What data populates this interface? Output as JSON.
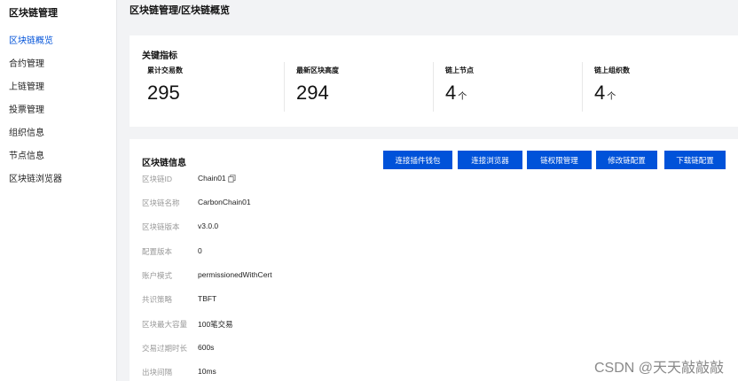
{
  "sidebar": {
    "title": "区块链管理",
    "items": [
      {
        "label": "区块链概览",
        "active": true
      },
      {
        "label": "合约管理",
        "active": false
      },
      {
        "label": "上链管理",
        "active": false
      },
      {
        "label": "投票管理",
        "active": false
      },
      {
        "label": "组织信息",
        "active": false
      },
      {
        "label": "节点信息",
        "active": false
      },
      {
        "label": "区块链浏览器",
        "active": false
      }
    ]
  },
  "header": {
    "breadcrumb": "区块链管理/区块链概览"
  },
  "kpi": {
    "title": "关键指标",
    "metrics": [
      {
        "label": "累计交易数",
        "value": "295",
        "unit": ""
      },
      {
        "label": "最新区块高度",
        "value": "294",
        "unit": ""
      },
      {
        "label": "链上节点",
        "value": "4",
        "unit": "个"
      },
      {
        "label": "链上组织数",
        "value": "4",
        "unit": "个"
      }
    ]
  },
  "info": {
    "title": "区块链信息",
    "buttons": [
      {
        "label": "连接插件钱包"
      },
      {
        "label": "连接浏览器"
      },
      {
        "label": "链权限管理"
      },
      {
        "label": "修改链配置"
      },
      {
        "label": "下载链配置"
      }
    ],
    "rows": [
      {
        "label": "区块链ID",
        "value": "Chain01"
      },
      {
        "label": "区块链名称",
        "value": "CarbonChain01"
      },
      {
        "label": "区块链版本",
        "value": "v3.0.0"
      },
      {
        "label": "配置版本",
        "value": "0"
      },
      {
        "label": "账户模式",
        "value": "permissionedWithCert"
      },
      {
        "label": "共识策略",
        "value": "TBFT"
      },
      {
        "label": "区块最大容量",
        "value": "100笔交易"
      },
      {
        "label": "交易过期时长",
        "value": "600s"
      },
      {
        "label": "出块间隔",
        "value": "10ms"
      }
    ]
  },
  "watermark": "CSDN @天天敲敲敲",
  "colors": {
    "primary": "#0052d9",
    "label_gray": "#999999",
    "background": "#f2f3f5"
  }
}
